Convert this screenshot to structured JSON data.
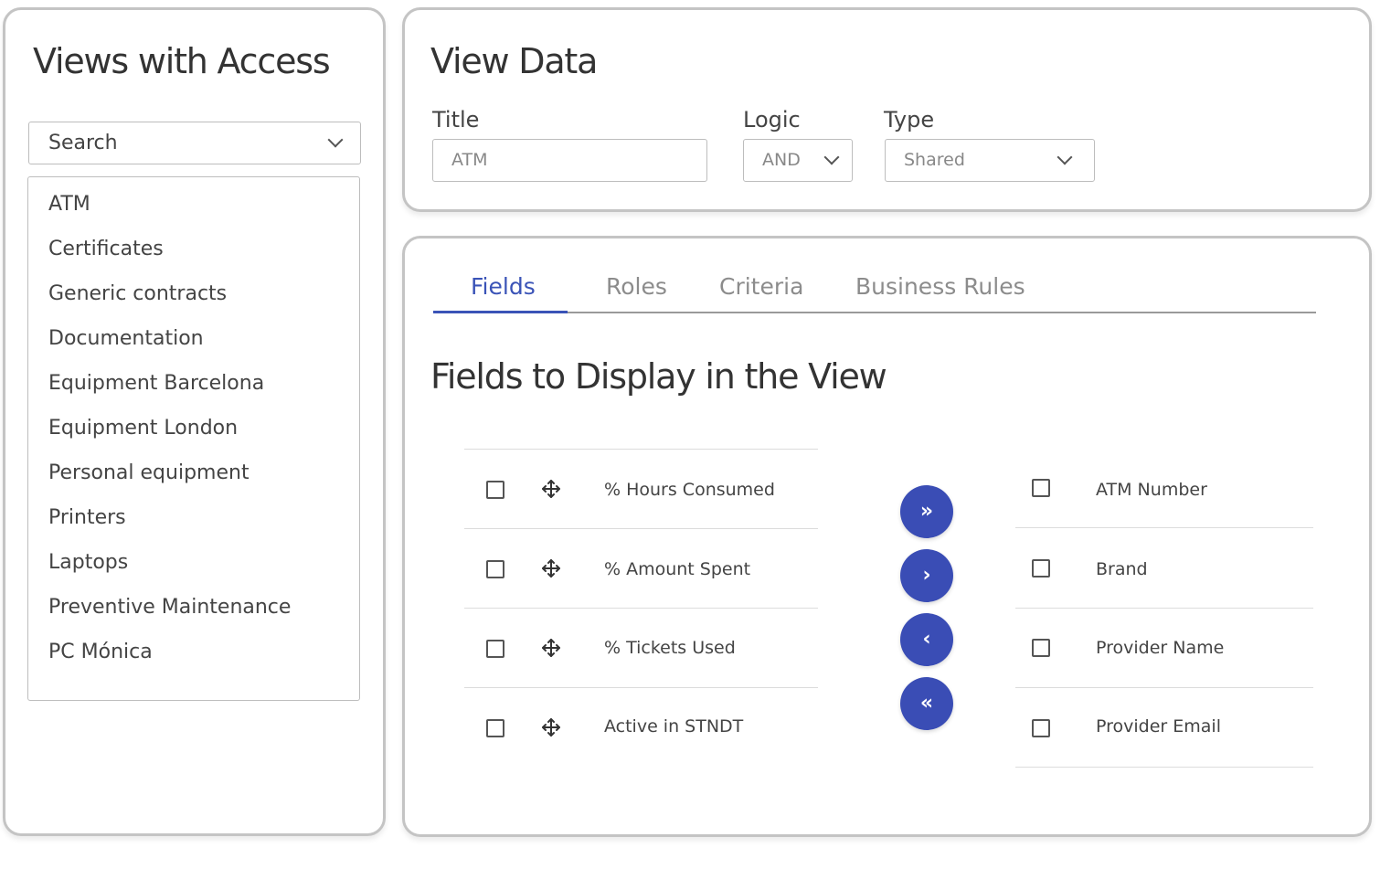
{
  "views_panel": {
    "title": "Views with Access",
    "search_label": "Search",
    "items": [
      "ATM",
      "Certificates",
      "Generic contracts",
      "Documentation",
      "Equipment Barcelona",
      "Equipment London",
      "Personal equipment",
      "Printers",
      "Laptops",
      "Preventive Maintenance",
      "PC Mónica"
    ]
  },
  "view_data": {
    "title": "View Data",
    "title_label": "Title",
    "title_value": "ATM",
    "logic_label": "Logic",
    "logic_value": "AND",
    "type_label": "Type",
    "type_value": "Shared"
  },
  "tabs": [
    "Fields",
    "Roles",
    "Criteria",
    "Business Rules"
  ],
  "active_tab": "Fields",
  "fields_section": {
    "title": "Fields to Display in the View",
    "available": [
      "% Hours Consumed",
      "% Amount Spent",
      "% Tickets Used",
      "Active in STNDT"
    ],
    "selected": [
      "ATM Number",
      "Brand",
      "Provider Name",
      "Provider Email"
    ],
    "buttons": {
      "add_all": "»",
      "add": "›",
      "remove": "‹",
      "remove_all": "«"
    }
  },
  "colors": {
    "accent": "#3a53b7",
    "button": "#3a4db5",
    "border": "#c4c4c4"
  }
}
